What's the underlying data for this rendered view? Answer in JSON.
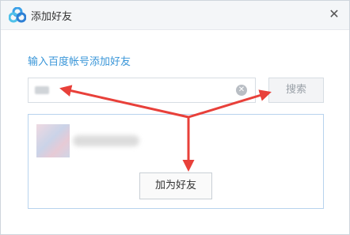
{
  "window": {
    "title": "添加好友",
    "close_glyph": "✕"
  },
  "icons": {
    "app": "baidu-cloud-logo-icon",
    "close": "close-icon",
    "clear": "clear-input-icon"
  },
  "prompt": "输入百度帐号添加好友",
  "search": {
    "value": "",
    "clear_glyph": "✕",
    "button_label": "搜索"
  },
  "result": {
    "name": "",
    "add_button_label": "加为好友"
  },
  "colors": {
    "accent": "#3a96d8",
    "annotation": "#e8403a",
    "panel_border": "#b8d3ee"
  }
}
